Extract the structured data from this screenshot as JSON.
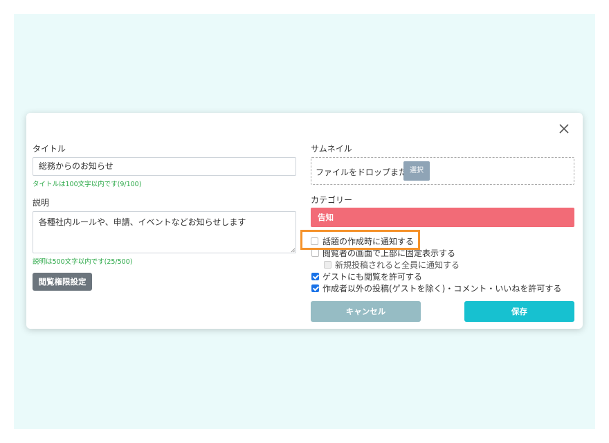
{
  "form": {
    "title_label": "タイトル",
    "title_value": "総務からのお知らせ",
    "title_hint": "タイトルは100文字以内です(9/100)",
    "description_label": "説明",
    "description_value": "各種社内ルールや、申請、イベントなどお知らせします",
    "description_hint": "説明は500文字以内です(25/500)",
    "permission_button": "閲覧権限設定",
    "thumbnail_label": "サムネイル",
    "thumbnail_drop_text": "ファイルをドロップまたは",
    "thumbnail_select_button": "選択",
    "category_label": "カテゴリー",
    "category_value": "告知",
    "category_color": "#f26b77"
  },
  "options": [
    {
      "label": "話題の作成時に通知する",
      "checked": false
    },
    {
      "label": "閲覧者の画面で上部に固定表示する",
      "checked": false
    },
    {
      "label": "新規投稿されると全員に通知する",
      "checked": false,
      "disabled": true
    },
    {
      "label": "ゲストにも閲覧を許可する",
      "checked": true
    },
    {
      "label": "作成者以外の投稿(ゲストを除く)・コメント・いいねを許可する",
      "checked": true
    }
  ],
  "actions": {
    "cancel_label": "キャンセル",
    "save_label": "保存",
    "cancel_color": "#96bcc4",
    "save_color": "#17c1d0"
  },
  "icons": {
    "close": "close-icon"
  }
}
